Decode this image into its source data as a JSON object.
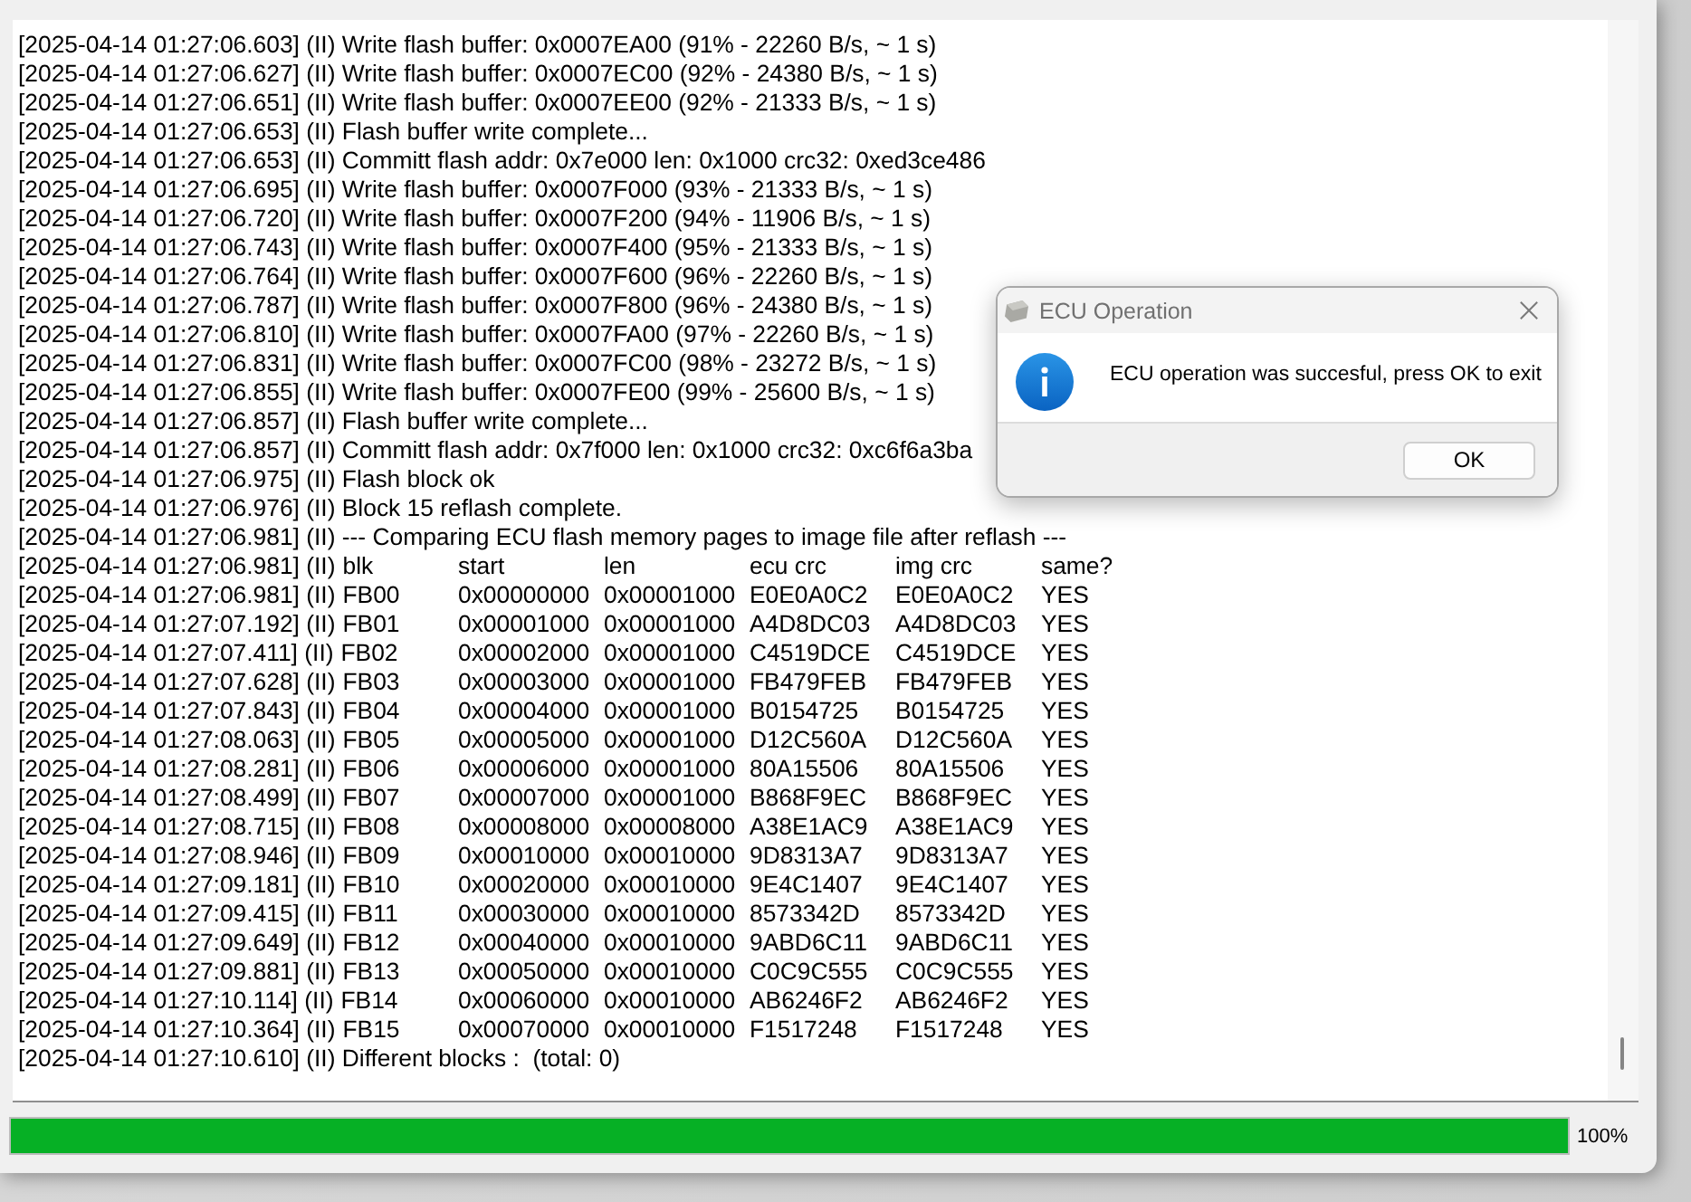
{
  "log": {
    "lines": [
      {
        "kind": "text",
        "text": "[2025-04-14 01:27:06.603] (II) Write flash buffer: 0x0007EA00 (91% - 22260 B/s, ~ 1 s)"
      },
      {
        "kind": "text",
        "text": "[2025-04-14 01:27:06.627] (II) Write flash buffer: 0x0007EC00 (92% - 24380 B/s, ~ 1 s)"
      },
      {
        "kind": "text",
        "text": "[2025-04-14 01:27:06.651] (II) Write flash buffer: 0x0007EE00 (92% - 21333 B/s, ~ 1 s)"
      },
      {
        "kind": "text",
        "text": "[2025-04-14 01:27:06.653] (II) Flash buffer write complete..."
      },
      {
        "kind": "text",
        "text": "[2025-04-14 01:27:06.653] (II) Committ flash addr: 0x7e000 len: 0x1000 crc32: 0xed3ce486"
      },
      {
        "kind": "text",
        "text": "[2025-04-14 01:27:06.695] (II) Write flash buffer: 0x0007F000 (93% - 21333 B/s, ~ 1 s)"
      },
      {
        "kind": "text",
        "text": "[2025-04-14 01:27:06.720] (II) Write flash buffer: 0x0007F200 (94% - 11906 B/s, ~ 1 s)"
      },
      {
        "kind": "text",
        "text": "[2025-04-14 01:27:06.743] (II) Write flash buffer: 0x0007F400 (95% - 21333 B/s, ~ 1 s)"
      },
      {
        "kind": "text",
        "text": "[2025-04-14 01:27:06.764] (II) Write flash buffer: 0x0007F600 (96% - 22260 B/s, ~ 1 s)"
      },
      {
        "kind": "text",
        "text": "[2025-04-14 01:27:06.787] (II) Write flash buffer: 0x0007F800 (96% - 24380 B/s, ~ 1 s)"
      },
      {
        "kind": "text",
        "text": "[2025-04-14 01:27:06.810] (II) Write flash buffer: 0x0007FA00 (97% - 22260 B/s, ~ 1 s)"
      },
      {
        "kind": "text",
        "text": "[2025-04-14 01:27:06.831] (II) Write flash buffer: 0x0007FC00 (98% - 23272 B/s, ~ 1 s)"
      },
      {
        "kind": "text",
        "text": "[2025-04-14 01:27:06.855] (II) Write flash buffer: 0x0007FE00 (99% - 25600 B/s, ~ 1 s)"
      },
      {
        "kind": "text",
        "text": "[2025-04-14 01:27:06.857] (II) Flash buffer write complete..."
      },
      {
        "kind": "text",
        "text": "[2025-04-14 01:27:06.857] (II) Committ flash addr: 0x7f000 len: 0x1000 crc32: 0xc6f6a3ba"
      },
      {
        "kind": "text",
        "text": "[2025-04-14 01:27:06.975] (II) Flash block ok"
      },
      {
        "kind": "text",
        "text": "[2025-04-14 01:27:06.976] (II) Block 15 reflash complete."
      },
      {
        "kind": "text",
        "text": "[2025-04-14 01:27:06.981] (II) --- Comparing ECU flash memory pages to image file after reflash ---"
      },
      {
        "kind": "table_header",
        "prefix": "[2025-04-14 01:27:06.981] (II)",
        "cells": [
          "blk",
          "start",
          "len",
          "ecu crc",
          "img crc",
          "same?"
        ]
      },
      {
        "kind": "table_row",
        "prefix": "[2025-04-14 01:27:06.981] (II)",
        "cells": [
          "FB00",
          "0x00000000",
          "0x00001000",
          "E0E0A0C2",
          "E0E0A0C2",
          "YES"
        ]
      },
      {
        "kind": "table_row",
        "prefix": "[2025-04-14 01:27:07.192] (II)",
        "cells": [
          "FB01",
          "0x00001000",
          "0x00001000",
          "A4D8DC03",
          "A4D8DC03",
          "YES"
        ]
      },
      {
        "kind": "table_row",
        "prefix": "[2025-04-14 01:27:07.411] (II)",
        "cells": [
          "FB02",
          "0x00002000",
          "0x00001000",
          "C4519DCE",
          "C4519DCE",
          "YES"
        ]
      },
      {
        "kind": "table_row",
        "prefix": "[2025-04-14 01:27:07.628] (II)",
        "cells": [
          "FB03",
          "0x00003000",
          "0x00001000",
          "FB479FEB",
          "FB479FEB",
          "YES"
        ]
      },
      {
        "kind": "table_row",
        "prefix": "[2025-04-14 01:27:07.843] (II)",
        "cells": [
          "FB04",
          "0x00004000",
          "0x00001000",
          "B0154725",
          "B0154725",
          "YES"
        ]
      },
      {
        "kind": "table_row",
        "prefix": "[2025-04-14 01:27:08.063] (II)",
        "cells": [
          "FB05",
          "0x00005000",
          "0x00001000",
          "D12C560A",
          "D12C560A",
          "YES"
        ]
      },
      {
        "kind": "table_row",
        "prefix": "[2025-04-14 01:27:08.281] (II)",
        "cells": [
          "FB06",
          "0x00006000",
          "0x00001000",
          "80A15506",
          "80A15506",
          "YES"
        ]
      },
      {
        "kind": "table_row",
        "prefix": "[2025-04-14 01:27:08.499] (II)",
        "cells": [
          "FB07",
          "0x00007000",
          "0x00001000",
          "B868F9EC",
          "B868F9EC",
          "YES"
        ]
      },
      {
        "kind": "table_row",
        "prefix": "[2025-04-14 01:27:08.715] (II)",
        "cells": [
          "FB08",
          "0x00008000",
          "0x00008000",
          "A38E1AC9",
          "A38E1AC9",
          "YES"
        ]
      },
      {
        "kind": "table_row",
        "prefix": "[2025-04-14 01:27:08.946] (II)",
        "cells": [
          "FB09",
          "0x00010000",
          "0x00010000",
          "9D8313A7",
          "9D8313A7",
          "YES"
        ]
      },
      {
        "kind": "table_row",
        "prefix": "[2025-04-14 01:27:09.181] (II)",
        "cells": [
          "FB10",
          "0x00020000",
          "0x00010000",
          "9E4C1407",
          "9E4C1407",
          "YES"
        ]
      },
      {
        "kind": "table_row",
        "prefix": "[2025-04-14 01:27:09.415] (II)",
        "cells": [
          "FB11",
          "0x00030000",
          "0x00010000",
          "8573342D",
          "8573342D",
          "YES"
        ]
      },
      {
        "kind": "table_row",
        "prefix": "[2025-04-14 01:27:09.649] (II)",
        "cells": [
          "FB12",
          "0x00040000",
          "0x00010000",
          "9ABD6C11",
          "9ABD6C11",
          "YES"
        ]
      },
      {
        "kind": "table_row",
        "prefix": "[2025-04-14 01:27:09.881] (II)",
        "cells": [
          "FB13",
          "0x00050000",
          "0x00010000",
          "C0C9C555",
          "C0C9C555",
          "YES"
        ]
      },
      {
        "kind": "table_row",
        "prefix": "[2025-04-14 01:27:10.114] (II)",
        "cells": [
          "FB14",
          "0x00060000",
          "0x00010000",
          "AB6246F2",
          "AB6246F2",
          "YES"
        ]
      },
      {
        "kind": "table_row",
        "prefix": "[2025-04-14 01:27:10.364] (II)",
        "cells": [
          "FB15",
          "0x00070000",
          "0x00010000",
          "F1517248",
          "F1517248",
          "YES"
        ]
      },
      {
        "kind": "text",
        "text": "[2025-04-14 01:27:10.610] (II) Different blocks :  (total: 0)"
      }
    ]
  },
  "progress": {
    "level": 1,
    "reading": "100%"
  },
  "dialog": {
    "title": "ECU Operation",
    "message": "ECU operation was succesful, press OK to exit",
    "buttons": [
      "OK"
    ]
  }
}
